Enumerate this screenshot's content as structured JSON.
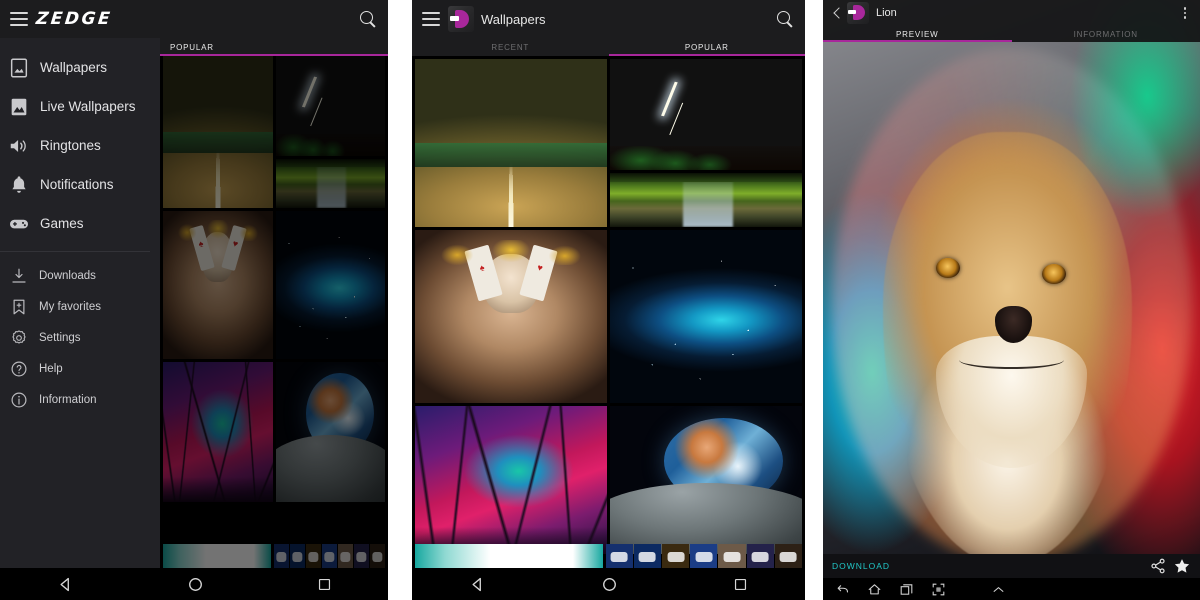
{
  "meta": {
    "app_name": "ZEDGE",
    "accent_magenta": "#a8279b",
    "accent_cyan": "#21c7c7",
    "bar_background": "#1c1c1e",
    "drawer_background": "#222226"
  },
  "panel1": {
    "appbar": {
      "menu_icon": "hamburger-icon",
      "brand": "ZEDGE",
      "search_icon": "search-icon"
    },
    "drawer": {
      "primary": [
        {
          "label": "Wallpapers",
          "icon": "image-frame-icon"
        },
        {
          "label": "Live Wallpapers",
          "icon": "mountain-icon"
        },
        {
          "label": "Ringtones",
          "icon": "speaker-icon"
        },
        {
          "label": "Notifications",
          "icon": "bell-icon"
        },
        {
          "label": "Games",
          "icon": "gamepad-icon"
        }
      ],
      "secondary": [
        {
          "label": "My favorites",
          "icon": "bookmark-plus-icon"
        },
        {
          "label": "Settings",
          "icon": "gear-icon"
        },
        {
          "label": "Help",
          "icon": "help-circle-icon"
        },
        {
          "label": "Information",
          "icon": "info-circle-icon"
        }
      ],
      "downloads": {
        "label": "Downloads",
        "icon": "download-icon"
      }
    },
    "tabs": [
      {
        "label": "POPULAR",
        "active": true
      }
    ],
    "sysnav": [
      {
        "icon": "back-triangle-icon"
      },
      {
        "icon": "home-circle-icon"
      },
      {
        "icon": "recents-square-icon"
      }
    ]
  },
  "panel2": {
    "appbar": {
      "menu_icon": "hamburger-icon",
      "logo": "zedge-d-logo",
      "title": "Wallpapers",
      "search_icon": "search-icon"
    },
    "tabs": [
      {
        "label": "RECENT",
        "active": false
      },
      {
        "label": "POPULAR",
        "active": true
      }
    ],
    "grid": {
      "column_left": [
        {
          "name": "open-road-sunset-wallpaper"
        },
        {
          "name": "skull-queens-playing-cards-wallpaper"
        },
        {
          "name": "purple-nebula-forest-wallpaper"
        }
      ],
      "column_right": [
        {
          "name": "lightning-storm-red-sunset-wallpaper"
        },
        {
          "name": "wet-country-road-green-field-wallpaper"
        },
        {
          "name": "blue-nebula-galaxy-wallpaper"
        },
        {
          "name": "earth-rise-over-moon-wallpaper"
        }
      ]
    },
    "sysnav": [
      {
        "icon": "back-triangle-icon"
      },
      {
        "icon": "home-circle-icon"
      },
      {
        "icon": "recents-square-icon"
      }
    ]
  },
  "panel3": {
    "appbar": {
      "back_icon": "back-arrow-icon",
      "logo": "zedge-d-logo",
      "title": "Lion",
      "overflow_icon": "overflow-menu-icon"
    },
    "tabs": [
      {
        "label": "PREVIEW",
        "active": true
      },
      {
        "label": "INFORMATION",
        "active": false
      }
    ],
    "artwork": {
      "name": "colorful-lion-wallpaper"
    },
    "footer": {
      "download_label": "DOWNLOAD",
      "share_icon": "share-icon",
      "favorite_icon": "star-icon"
    },
    "sysnav": [
      {
        "icon": "back-arrow-icon"
      },
      {
        "icon": "home-outline-icon"
      },
      {
        "icon": "recents-stack-icon"
      },
      {
        "icon": "screenshot-icon"
      },
      {
        "icon": "chevron-up-icon"
      }
    ]
  }
}
